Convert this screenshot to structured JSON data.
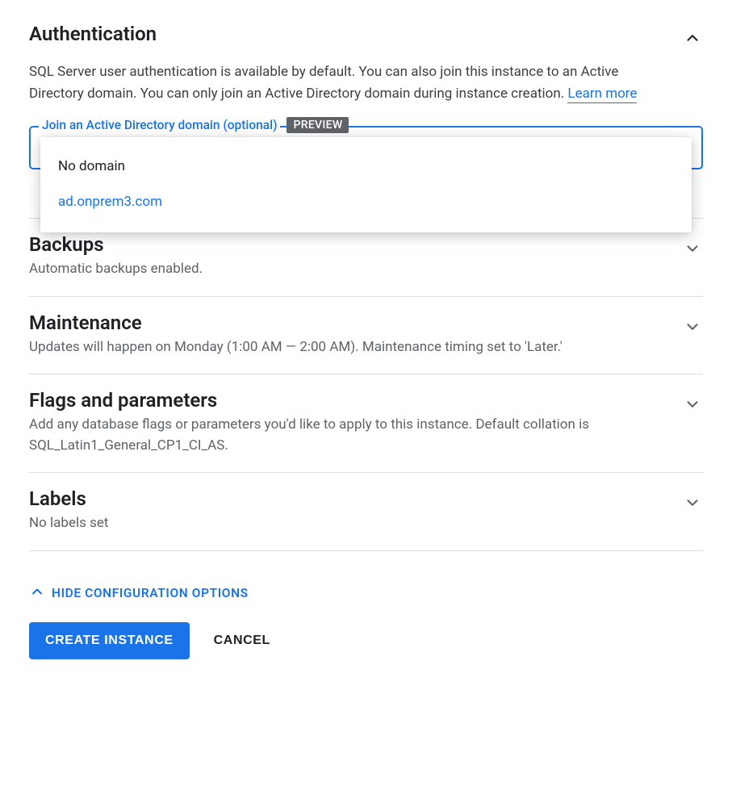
{
  "sections": {
    "authentication": {
      "title": "Authentication",
      "body_text": "SQL Server user authentication is available by default. You can also join this instance to an Active Directory domain. You can only join an Active Directory domain during instance creation. ",
      "learn_more": "Learn more",
      "ad_field": {
        "label": "Join an Active Directory domain (optional)",
        "badge": "PREVIEW",
        "options": {
          "no_domain": "No domain",
          "domain1": "ad.onprem3.com"
        }
      }
    },
    "backups": {
      "title": "Backups",
      "subtitle": "Automatic backups enabled."
    },
    "maintenance": {
      "title": "Maintenance",
      "subtitle": "Updates will happen on Monday (1:00 AM — 2:00 AM). Maintenance timing set to 'Later.'"
    },
    "flags": {
      "title": "Flags and parameters",
      "subtitle": "Add any database flags or parameters you'd like to apply to this instance. Default collation is SQL_Latin1_General_CP1_CI_AS."
    },
    "labels": {
      "title": "Labels",
      "subtitle": "No labels set"
    }
  },
  "hide_config_label": "HIDE CONFIGURATION OPTIONS",
  "buttons": {
    "create": "CREATE INSTANCE",
    "cancel": "CANCEL"
  }
}
